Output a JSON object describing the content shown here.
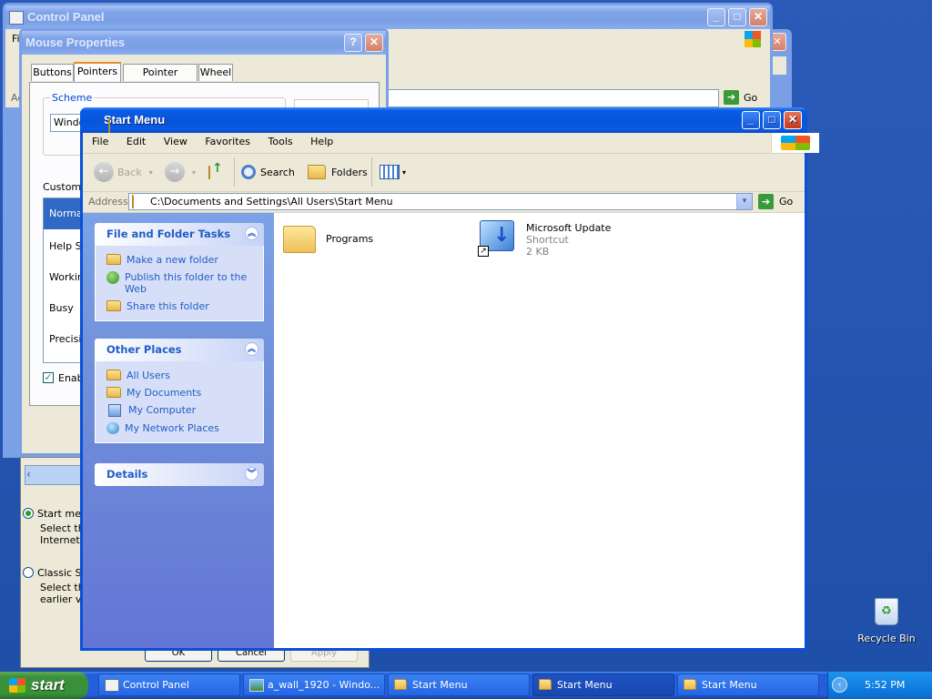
{
  "control_panel": {
    "title": "Control Panel",
    "menu_first": "Fi",
    "address_label": "Ad"
  },
  "mouse_props": {
    "title": "Mouse Properties",
    "tabs": [
      "Buttons",
      "Pointers",
      "Pointer Options",
      "Wheel"
    ],
    "scheme_label": "Scheme",
    "scheme_value": "Windo",
    "customize_label": "Customiz",
    "pointer_items": [
      "Normal",
      "Help Se",
      "Workin",
      "Busy",
      "Precisio"
    ],
    "enable_label": "Enab"
  },
  "taskbar_props": {
    "opt1_label": "Start menu",
    "opt1_desc_1": "Select thi",
    "opt1_desc_2": "Internet, e",
    "opt2_label": "Classic Sta",
    "opt2_desc_1": "Select thi",
    "opt2_desc_2": "earlier ver",
    "btn_ok": "OK",
    "btn_cancel": "Cancel",
    "btn_apply": "Apply"
  },
  "explorer": {
    "title": "Start Menu",
    "menu": [
      "File",
      "Edit",
      "View",
      "Favorites",
      "Tools",
      "Help"
    ],
    "toolbar": {
      "back": "Back",
      "search": "Search",
      "folders": "Folders"
    },
    "address_label": "Address",
    "address_value": "C:\\Documents and Settings\\All Users\\Start Menu",
    "go_label": "Go",
    "panels": {
      "file_tasks": {
        "title": "File and Folder Tasks",
        "items": [
          "Make a new folder",
          "Publish this folder to the Web",
          "Share this folder"
        ]
      },
      "other_places": {
        "title": "Other Places",
        "items": [
          "All Users",
          "My Documents",
          "My Computer",
          "My Network Places"
        ]
      },
      "details": {
        "title": "Details"
      }
    },
    "files": [
      {
        "name": "Programs",
        "type": "",
        "size": ""
      },
      {
        "name": "Microsoft Update",
        "type": "Shortcut",
        "size": "2 KB"
      }
    ]
  },
  "back_go_label": "Go",
  "desktop": {
    "recycle_bin": "Recycle Bin"
  },
  "taskbar": {
    "start": "start",
    "buttons": [
      "Control Panel",
      "a_wall_1920 - Windo...",
      "Start Menu",
      "Start Menu",
      "Start Menu"
    ],
    "clock": "5:52 PM"
  }
}
